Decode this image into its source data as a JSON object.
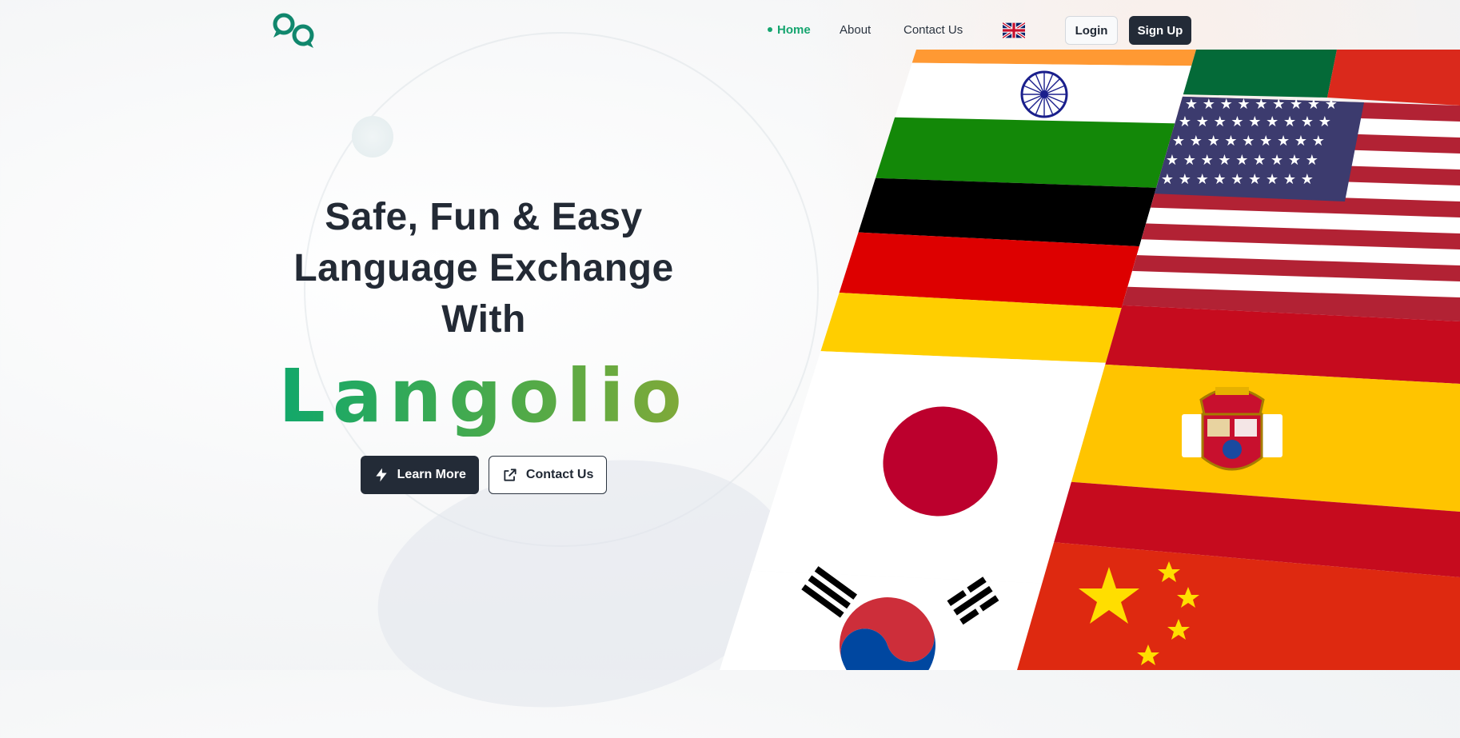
{
  "nav": {
    "links": [
      {
        "label": "Home",
        "active": true
      },
      {
        "label": "About",
        "active": false
      },
      {
        "label": "Contact Us",
        "active": false
      }
    ],
    "language_icon": "uk-flag-icon",
    "login_label": "Login",
    "signup_label": "Sign Up"
  },
  "hero": {
    "title_line1": "Safe, Fun & Easy",
    "title_line2": "Language Exchange",
    "title_line3": "With",
    "brand": "Langolio",
    "learn_more_label": "Learn More",
    "contact_label": "Contact Us"
  },
  "flags_shown": [
    "India",
    "Germany",
    "Japan",
    "South Korea",
    "Portugal",
    "United States",
    "Spain",
    "China",
    "United Kingdom"
  ],
  "colors": {
    "accent": "#15a56f",
    "dark": "#232b37",
    "brand_gradient_start": "#0aa86f",
    "brand_gradient_end": "#8aa935"
  }
}
